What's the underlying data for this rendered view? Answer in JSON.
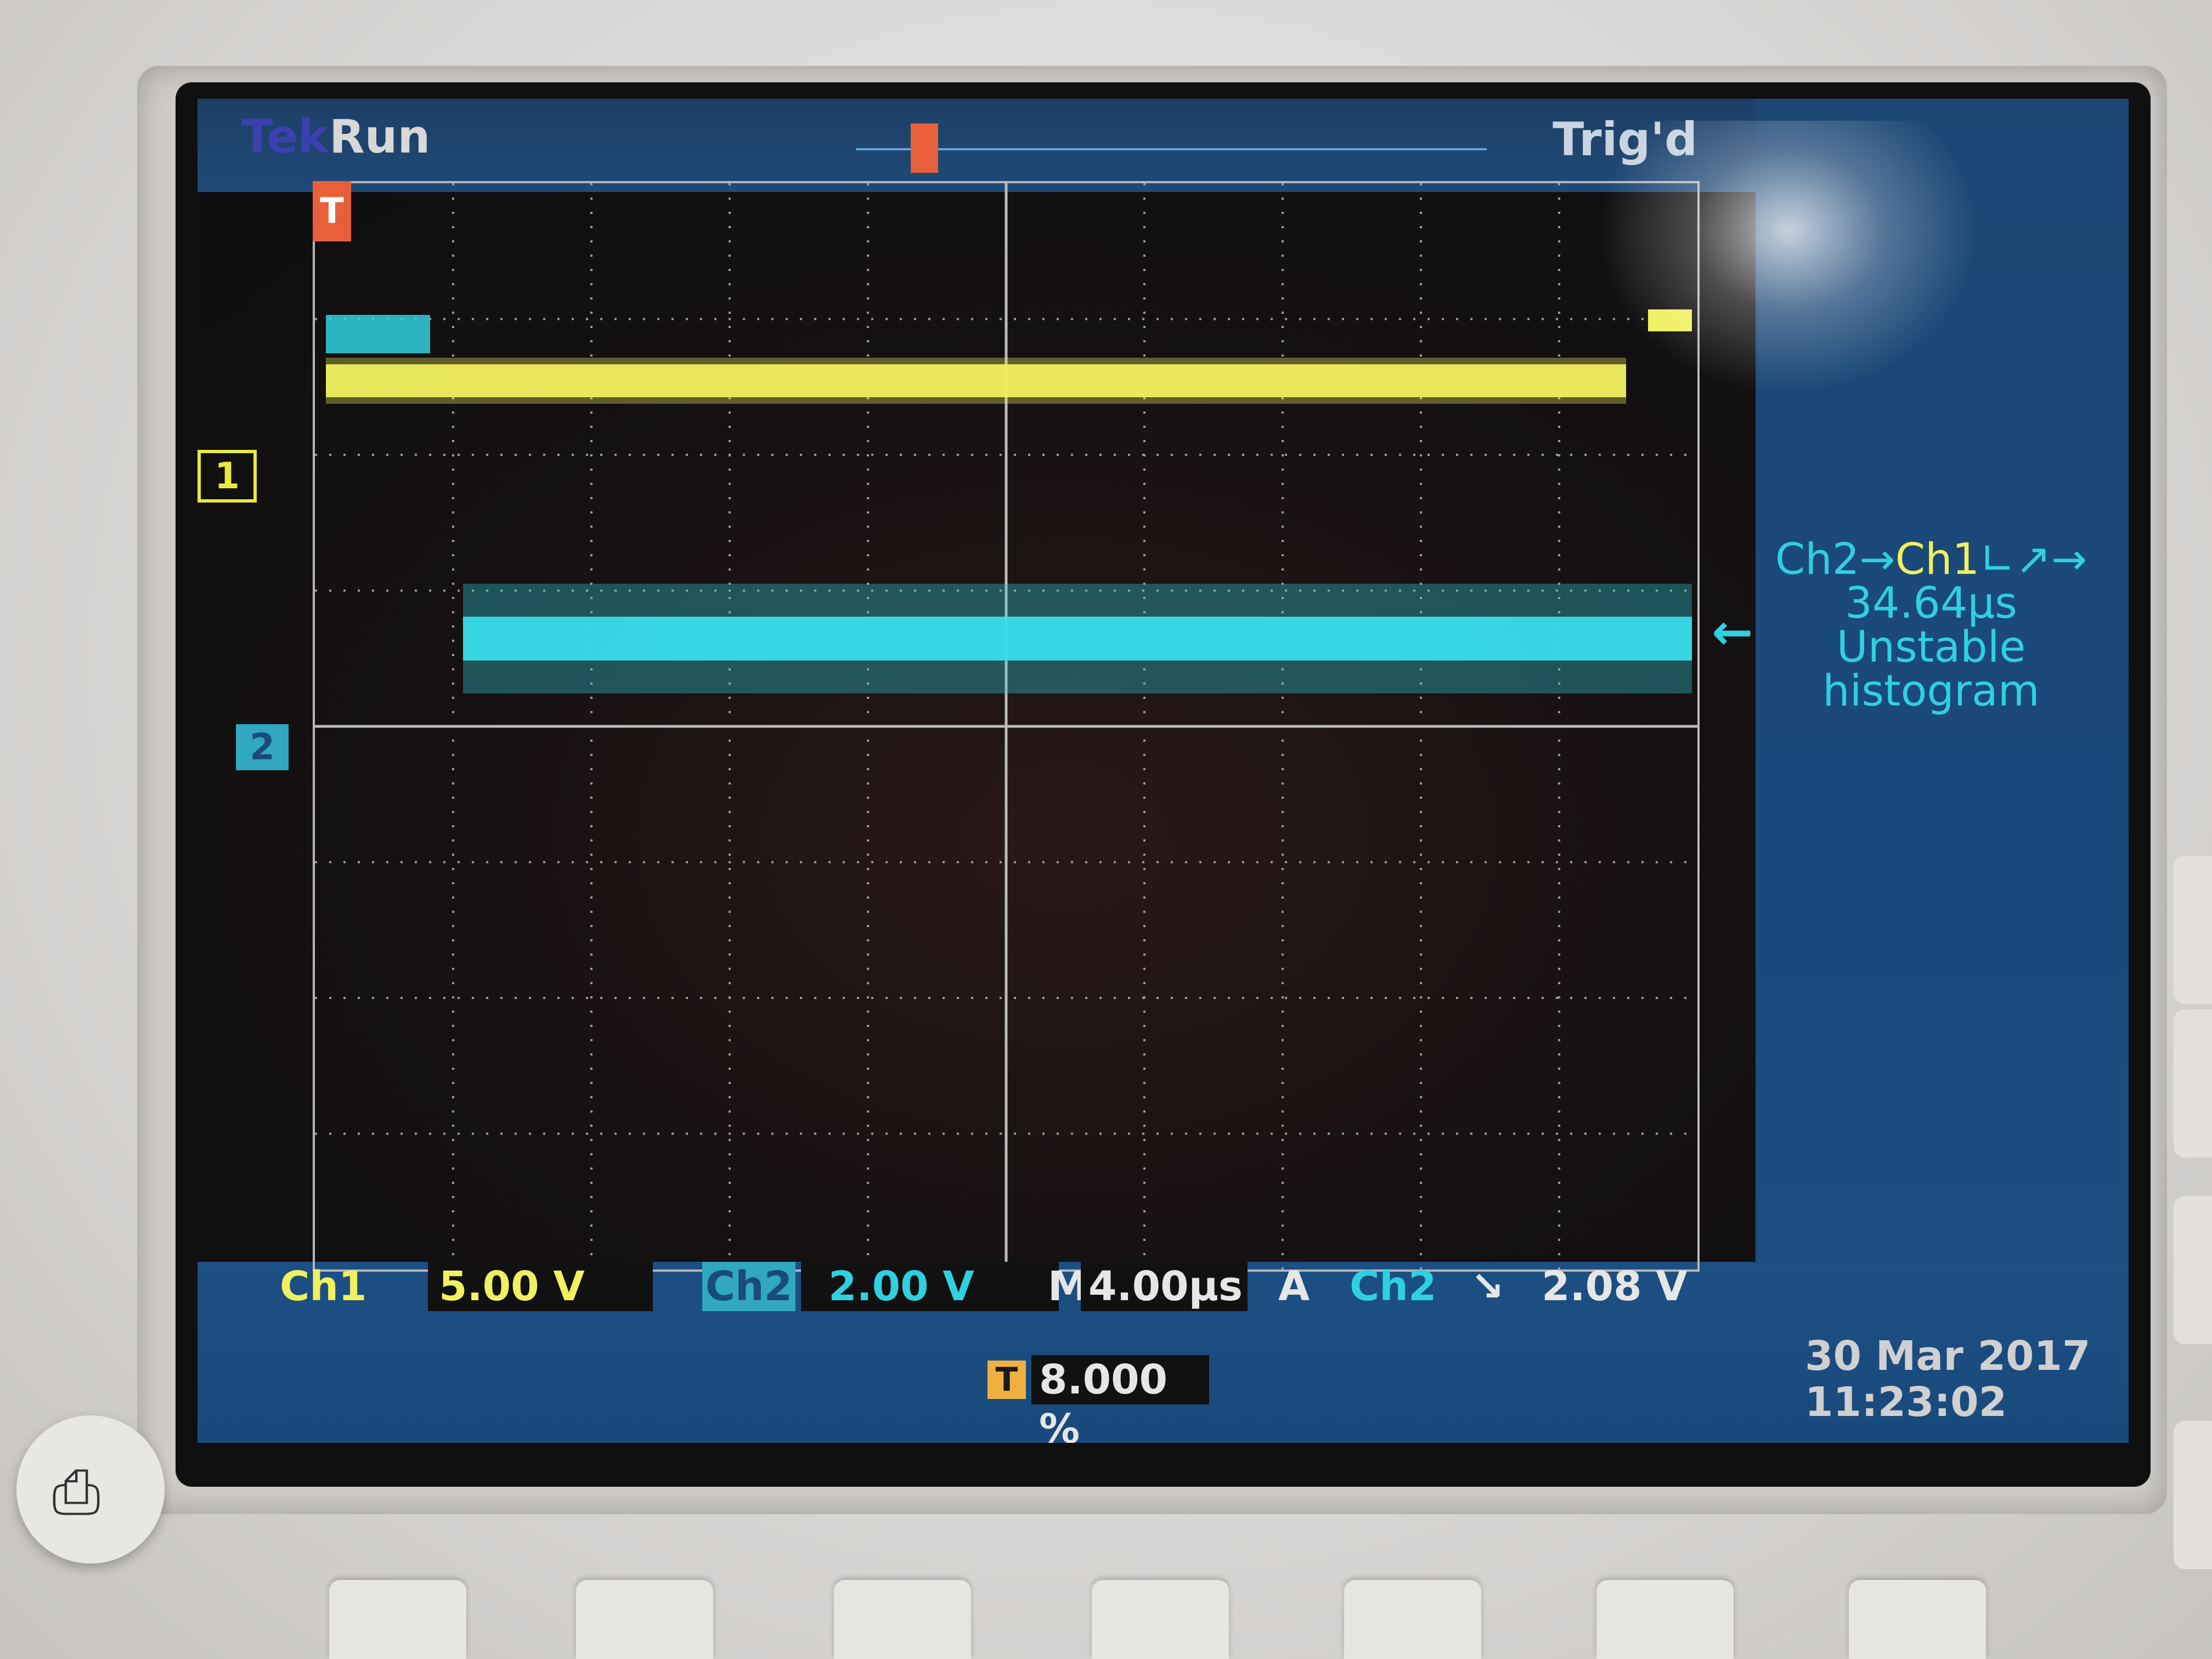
{
  "status": {
    "brand": "Tek",
    "acq_state": "Run",
    "trigger_state": "Trig'd"
  },
  "measurement": {
    "source_left": "Ch2",
    "arrow": "→",
    "source_right": "Ch1",
    "edges": "∟↗→",
    "value": "34.64µs",
    "line3": "Unstable",
    "line4": "histogram"
  },
  "channels": {
    "ch1_marker": "1",
    "ch2_marker": "2",
    "ch1_label": "Ch1",
    "ch1_scale": "5.00 V",
    "ch2_label": "Ch2",
    "ch2_scale": "2.00 V"
  },
  "timebase": {
    "m_label": "M",
    "m_value": "4.00µs"
  },
  "trigger": {
    "a_label": "A",
    "source": "Ch2",
    "slope": "↘",
    "level": "2.08 V",
    "t_badge": "T",
    "position": "8.000 %"
  },
  "datetime": {
    "date": "30 Mar 2017",
    "time": "11:23:02"
  },
  "colors": {
    "ch1": "#f0f060",
    "ch2": "#2fd0e0",
    "panel": "#1a4a7c",
    "trigger_marker": "#e8603a"
  },
  "icons": {
    "print": "printer-icon"
  }
}
